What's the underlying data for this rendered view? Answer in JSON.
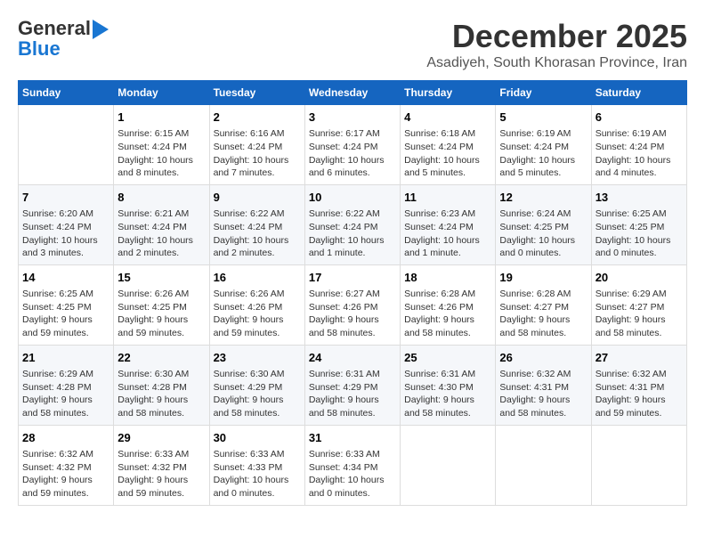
{
  "header": {
    "logo_line1": "General",
    "logo_line2": "Blue",
    "month_year": "December 2025",
    "location": "Asadiyeh, South Khorasan Province, Iran"
  },
  "weekdays": [
    "Sunday",
    "Monday",
    "Tuesday",
    "Wednesday",
    "Thursday",
    "Friday",
    "Saturday"
  ],
  "weeks": [
    [
      {
        "day": "",
        "info": ""
      },
      {
        "day": "1",
        "info": "Sunrise: 6:15 AM\nSunset: 4:24 PM\nDaylight: 10 hours\nand 8 minutes."
      },
      {
        "day": "2",
        "info": "Sunrise: 6:16 AM\nSunset: 4:24 PM\nDaylight: 10 hours\nand 7 minutes."
      },
      {
        "day": "3",
        "info": "Sunrise: 6:17 AM\nSunset: 4:24 PM\nDaylight: 10 hours\nand 6 minutes."
      },
      {
        "day": "4",
        "info": "Sunrise: 6:18 AM\nSunset: 4:24 PM\nDaylight: 10 hours\nand 5 minutes."
      },
      {
        "day": "5",
        "info": "Sunrise: 6:19 AM\nSunset: 4:24 PM\nDaylight: 10 hours\nand 5 minutes."
      },
      {
        "day": "6",
        "info": "Sunrise: 6:19 AM\nSunset: 4:24 PM\nDaylight: 10 hours\nand 4 minutes."
      }
    ],
    [
      {
        "day": "7",
        "info": "Sunrise: 6:20 AM\nSunset: 4:24 PM\nDaylight: 10 hours\nand 3 minutes."
      },
      {
        "day": "8",
        "info": "Sunrise: 6:21 AM\nSunset: 4:24 PM\nDaylight: 10 hours\nand 2 minutes."
      },
      {
        "day": "9",
        "info": "Sunrise: 6:22 AM\nSunset: 4:24 PM\nDaylight: 10 hours\nand 2 minutes."
      },
      {
        "day": "10",
        "info": "Sunrise: 6:22 AM\nSunset: 4:24 PM\nDaylight: 10 hours\nand 1 minute."
      },
      {
        "day": "11",
        "info": "Sunrise: 6:23 AM\nSunset: 4:24 PM\nDaylight: 10 hours\nand 1 minute."
      },
      {
        "day": "12",
        "info": "Sunrise: 6:24 AM\nSunset: 4:25 PM\nDaylight: 10 hours\nand 0 minutes."
      },
      {
        "day": "13",
        "info": "Sunrise: 6:25 AM\nSunset: 4:25 PM\nDaylight: 10 hours\nand 0 minutes."
      }
    ],
    [
      {
        "day": "14",
        "info": "Sunrise: 6:25 AM\nSunset: 4:25 PM\nDaylight: 9 hours\nand 59 minutes."
      },
      {
        "day": "15",
        "info": "Sunrise: 6:26 AM\nSunset: 4:25 PM\nDaylight: 9 hours\nand 59 minutes."
      },
      {
        "day": "16",
        "info": "Sunrise: 6:26 AM\nSunset: 4:26 PM\nDaylight: 9 hours\nand 59 minutes."
      },
      {
        "day": "17",
        "info": "Sunrise: 6:27 AM\nSunset: 4:26 PM\nDaylight: 9 hours\nand 58 minutes."
      },
      {
        "day": "18",
        "info": "Sunrise: 6:28 AM\nSunset: 4:26 PM\nDaylight: 9 hours\nand 58 minutes."
      },
      {
        "day": "19",
        "info": "Sunrise: 6:28 AM\nSunset: 4:27 PM\nDaylight: 9 hours\nand 58 minutes."
      },
      {
        "day": "20",
        "info": "Sunrise: 6:29 AM\nSunset: 4:27 PM\nDaylight: 9 hours\nand 58 minutes."
      }
    ],
    [
      {
        "day": "21",
        "info": "Sunrise: 6:29 AM\nSunset: 4:28 PM\nDaylight: 9 hours\nand 58 minutes."
      },
      {
        "day": "22",
        "info": "Sunrise: 6:30 AM\nSunset: 4:28 PM\nDaylight: 9 hours\nand 58 minutes."
      },
      {
        "day": "23",
        "info": "Sunrise: 6:30 AM\nSunset: 4:29 PM\nDaylight: 9 hours\nand 58 minutes."
      },
      {
        "day": "24",
        "info": "Sunrise: 6:31 AM\nSunset: 4:29 PM\nDaylight: 9 hours\nand 58 minutes."
      },
      {
        "day": "25",
        "info": "Sunrise: 6:31 AM\nSunset: 4:30 PM\nDaylight: 9 hours\nand 58 minutes."
      },
      {
        "day": "26",
        "info": "Sunrise: 6:32 AM\nSunset: 4:31 PM\nDaylight: 9 hours\nand 58 minutes."
      },
      {
        "day": "27",
        "info": "Sunrise: 6:32 AM\nSunset: 4:31 PM\nDaylight: 9 hours\nand 59 minutes."
      }
    ],
    [
      {
        "day": "28",
        "info": "Sunrise: 6:32 AM\nSunset: 4:32 PM\nDaylight: 9 hours\nand 59 minutes."
      },
      {
        "day": "29",
        "info": "Sunrise: 6:33 AM\nSunset: 4:32 PM\nDaylight: 9 hours\nand 59 minutes."
      },
      {
        "day": "30",
        "info": "Sunrise: 6:33 AM\nSunset: 4:33 PM\nDaylight: 10 hours\nand 0 minutes."
      },
      {
        "day": "31",
        "info": "Sunrise: 6:33 AM\nSunset: 4:34 PM\nDaylight: 10 hours\nand 0 minutes."
      },
      {
        "day": "",
        "info": ""
      },
      {
        "day": "",
        "info": ""
      },
      {
        "day": "",
        "info": ""
      }
    ]
  ]
}
